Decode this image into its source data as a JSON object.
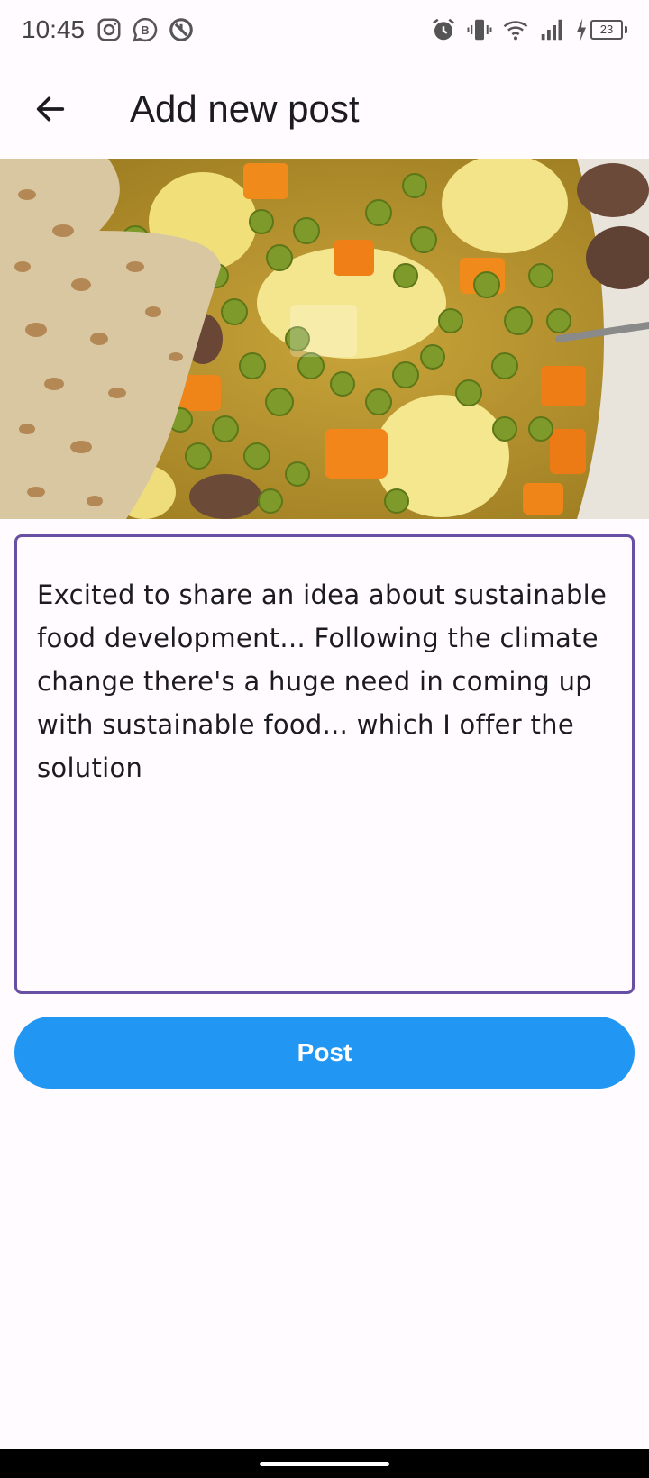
{
  "status_bar": {
    "time": "10:45",
    "left_icons": [
      "instagram-icon",
      "business-chat-icon",
      "data-saver-icon"
    ],
    "right_icons": [
      "alarm-icon",
      "vibrate-icon",
      "wifi-icon",
      "signal-icon",
      "charging-icon"
    ],
    "battery_level": "23"
  },
  "app_bar": {
    "back_icon": "arrow-back-icon",
    "title": "Add new post"
  },
  "image": {
    "description_icon": "food-photo"
  },
  "post_text": {
    "value": "Excited to share an idea about sustainable food development... Following the climate change there's a huge need in coming up with sustainable food... which I offer the solution"
  },
  "post_button": {
    "label": "Post"
  },
  "colors": {
    "accent": "#6750a4",
    "button": "#2196f3",
    "background": "#fffbfe"
  }
}
